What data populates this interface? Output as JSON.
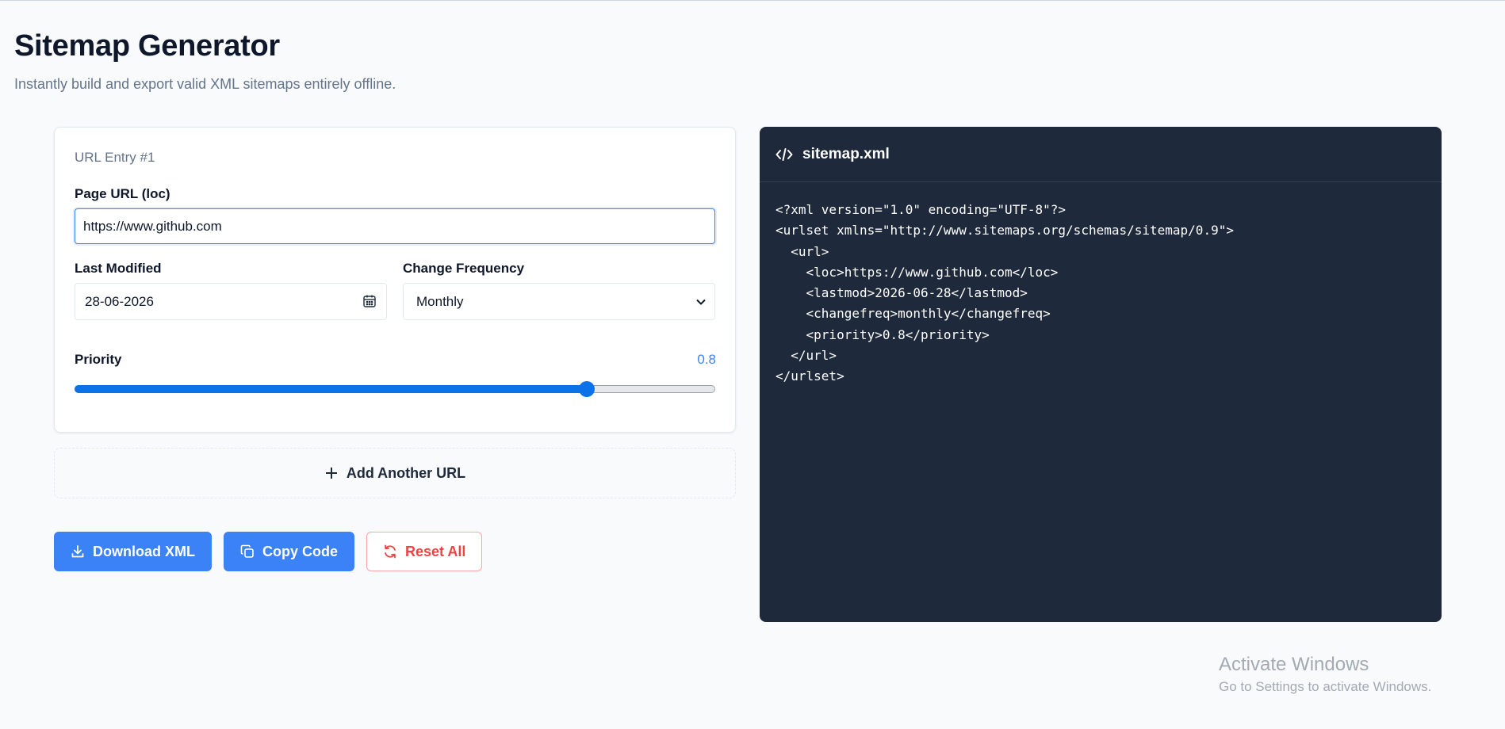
{
  "header": {
    "title": "Sitemap Generator",
    "subtitle": "Instantly build and export valid XML sitemaps entirely offline."
  },
  "entry": {
    "label": "URL Entry #1",
    "url_label": "Page URL (loc)",
    "url_value": "https://www.github.com",
    "lastmod_label": "Last Modified",
    "lastmod_value": "28-06-2026",
    "freq_label": "Change Frequency",
    "freq_value": "Monthly",
    "priority_label": "Priority",
    "priority_value": "0.8",
    "priority_fraction": 0.8
  },
  "add_button": {
    "label": "Add Another URL"
  },
  "actions": {
    "download_label": "Download XML",
    "copy_label": "Copy Code",
    "reset_label": "Reset All"
  },
  "code_panel": {
    "filename": "sitemap.xml",
    "code": "<?xml version=\"1.0\" encoding=\"UTF-8\"?>\n<urlset xmlns=\"http://www.sitemaps.org/schemas/sitemap/0.9\">\n  <url>\n    <loc>https://www.github.com</loc>\n    <lastmod>2026-06-28</lastmod>\n    <changefreq>monthly</changefreq>\n    <priority>0.8</priority>\n  </url>\n</urlset>"
  },
  "watermark": {
    "line1": "Activate Windows",
    "line2": "Go to Settings to activate Windows."
  },
  "colors": {
    "accent": "#3b82f6",
    "danger": "#ef4444",
    "code_bg": "#1e293b"
  }
}
